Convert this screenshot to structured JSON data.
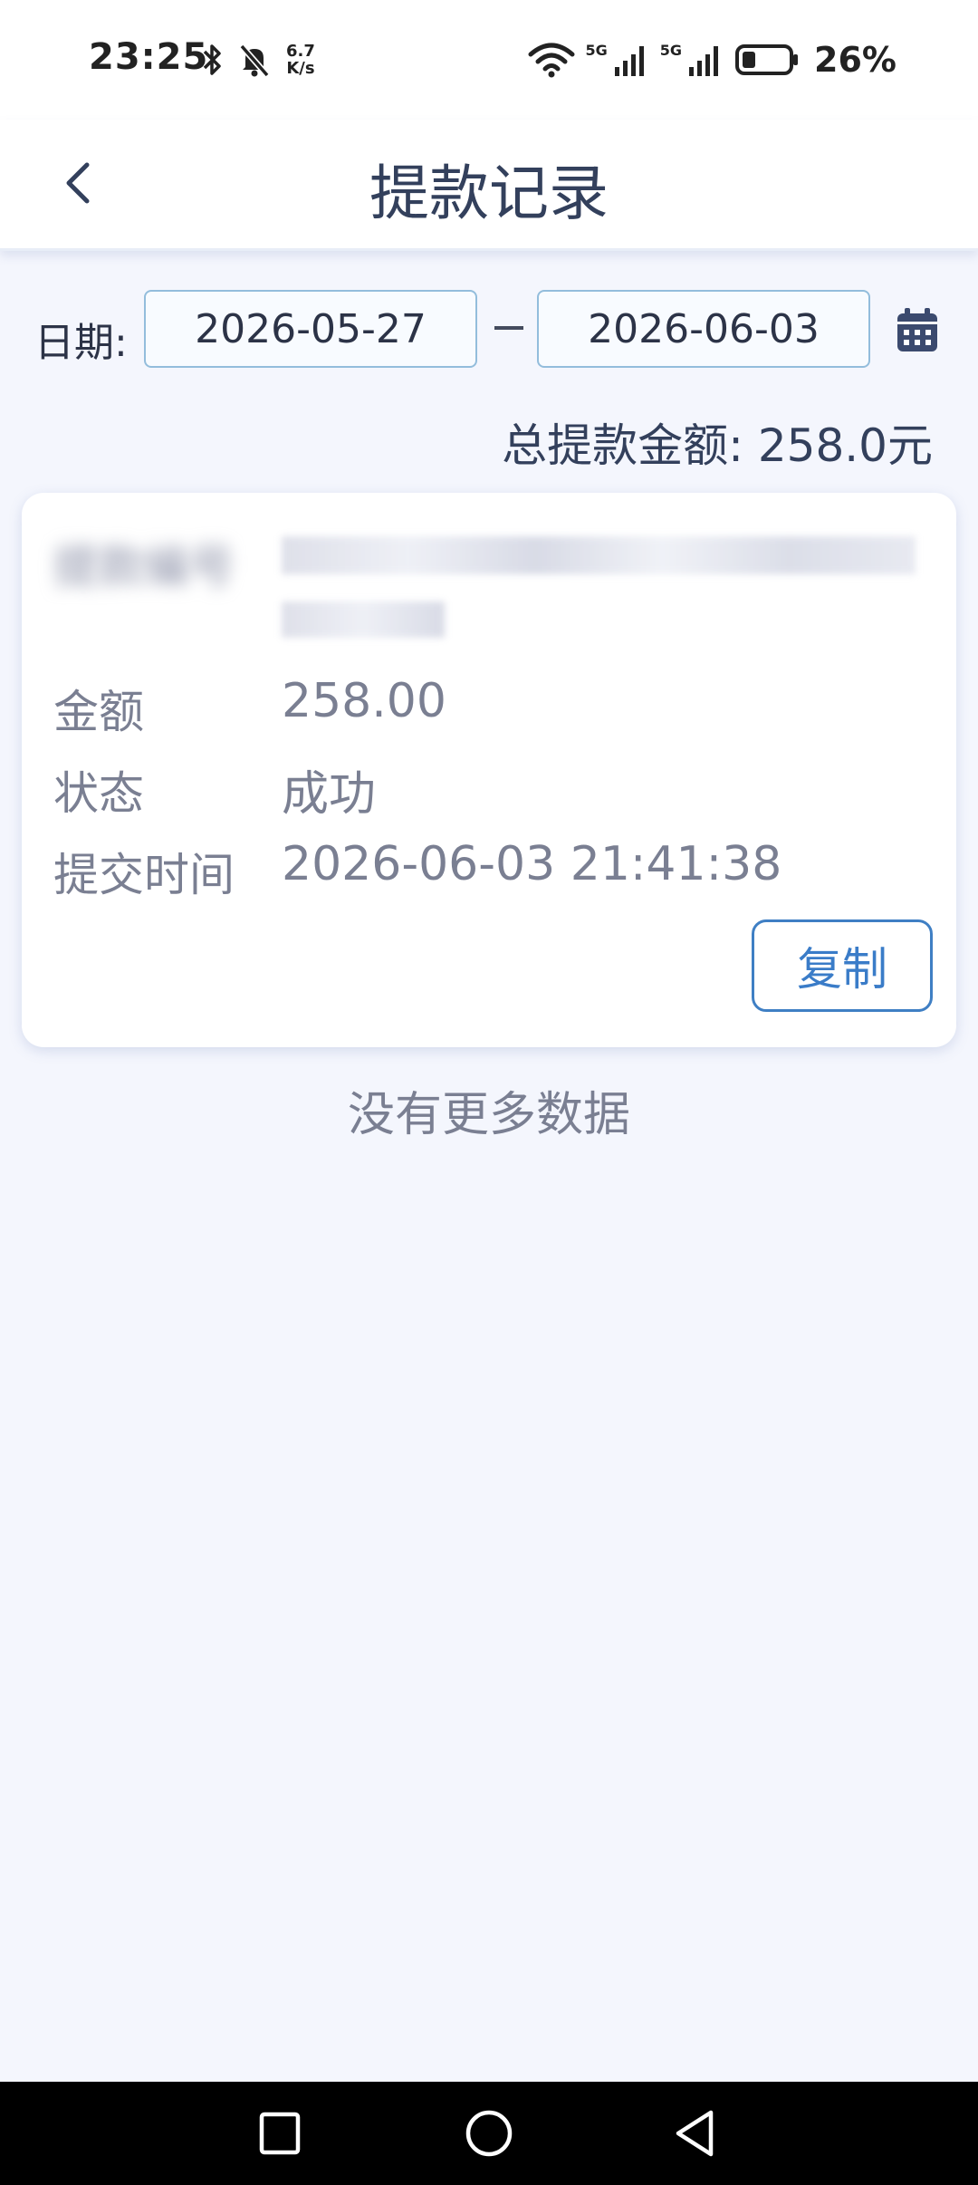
{
  "status_bar": {
    "time": "23:25",
    "net_speed_top": "6.7",
    "net_speed_bottom": "K/s",
    "sim1_label": "5G",
    "sim2_label": "5G",
    "battery_percent": "26%",
    "icons": [
      "bluetooth-icon",
      "silent-bell-icon",
      "wifi-icon",
      "signal-icon",
      "battery-icon"
    ]
  },
  "header": {
    "title": "提款记录"
  },
  "filter": {
    "date_label": "日期:",
    "start_date": "2026-05-27",
    "end_date": "2026-06-03",
    "calendar_icon": "calendar-icon"
  },
  "summary": {
    "total_text": "总提款金额: 258.0元"
  },
  "record": {
    "id_label": "提款编号",
    "id_value_line1": "",
    "id_value_line2": "",
    "amount_label": "金额",
    "amount_value": "258.00",
    "status_label": "状态",
    "status_value": "成功",
    "time_label": "提交时间",
    "time_value": "2026-06-03 21:41:38",
    "copy_label": "复制"
  },
  "footer": {
    "no_more_text": "没有更多数据"
  },
  "colors": {
    "background": "#f4f6fd",
    "accent": "#3f7fc4",
    "title": "#33405c",
    "muted_text": "#7a7f92"
  }
}
